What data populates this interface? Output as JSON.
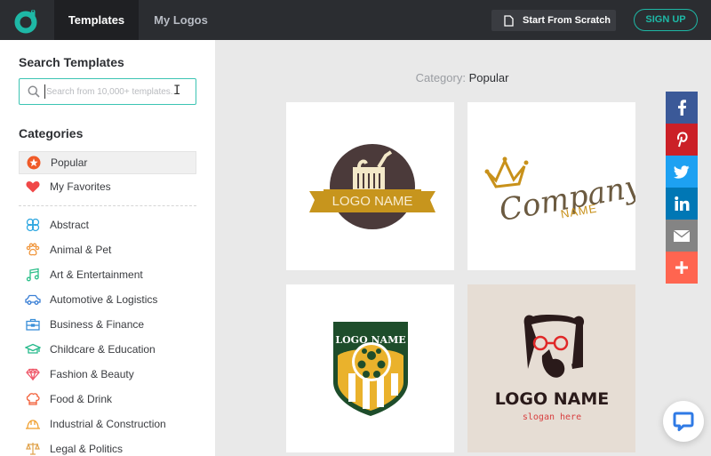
{
  "header": {
    "logo": "designevo-logo-icon",
    "tabs": [
      {
        "label": "Templates",
        "active": true
      },
      {
        "label": "My Logos",
        "active": false
      }
    ],
    "start_from_scratch": "Start From Scratch",
    "sign_up": "SIGN UP"
  },
  "sidebar": {
    "search_title": "Search Templates",
    "search_placeholder": "Search from 10,000+ templates...",
    "search_value": "",
    "categories_title": "Categories",
    "pinned": [
      {
        "label": "Popular",
        "icon": "star-circle-icon",
        "active": true
      },
      {
        "label": "My Favorites",
        "icon": "heart-icon",
        "active": false
      }
    ],
    "categories": [
      {
        "label": "Abstract",
        "icon": "abstract-icon"
      },
      {
        "label": "Animal & Pet",
        "icon": "paw-icon"
      },
      {
        "label": "Art & Entertainment",
        "icon": "music-note-icon"
      },
      {
        "label": "Automotive & Logistics",
        "icon": "car-icon"
      },
      {
        "label": "Business & Finance",
        "icon": "briefcase-icon"
      },
      {
        "label": "Childcare & Education",
        "icon": "graduation-cap-icon"
      },
      {
        "label": "Fashion & Beauty",
        "icon": "diamond-icon"
      },
      {
        "label": "Food & Drink",
        "icon": "chef-hat-icon"
      },
      {
        "label": "Industrial & Construction",
        "icon": "hard-hat-icon"
      },
      {
        "label": "Legal & Politics",
        "icon": "scales-icon"
      }
    ]
  },
  "main": {
    "category_key": "Category:",
    "category_value": "Popular",
    "templates": [
      {
        "name": "grocery-basket-logo",
        "text": "LOGO NAME"
      },
      {
        "name": "crown-company-logo",
        "text": "Company",
        "subtext": "NAME"
      },
      {
        "name": "soccer-shield-logo",
        "text": "LOGO NAME"
      },
      {
        "name": "bear-glasses-logo",
        "text": "LOGO NAME",
        "subtext": "slogan here"
      }
    ]
  },
  "share_bar": [
    {
      "name": "facebook",
      "color": "#3b5998"
    },
    {
      "name": "pinterest",
      "color": "#cb2027"
    },
    {
      "name": "twitter",
      "color": "#1da1f2"
    },
    {
      "name": "linkedin",
      "color": "#0077b5"
    },
    {
      "name": "email",
      "color": "#848484"
    },
    {
      "name": "more",
      "color": "#ff6550"
    }
  ],
  "colors": {
    "accent": "#1eb8a6",
    "topbar": "#2b2d31",
    "popular_icon": "#f05a28"
  }
}
